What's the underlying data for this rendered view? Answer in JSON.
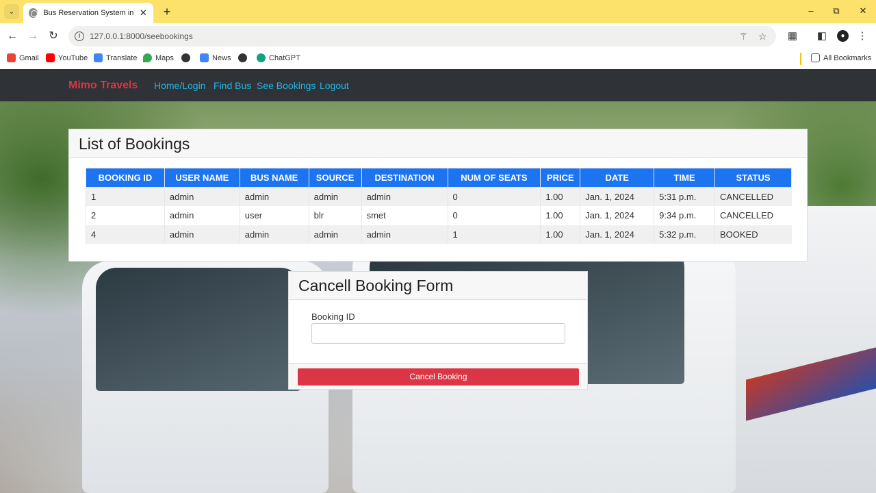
{
  "browser": {
    "tab_title": "Bus Reservation System in Djan",
    "url": "127.0.0.1:8000/seebookings",
    "bookmarks": [
      {
        "label": "Gmail",
        "icon": "gmail-icon",
        "color": "#ea4335"
      },
      {
        "label": "YouTube",
        "icon": "youtube-icon",
        "color": "#ff0000"
      },
      {
        "label": "Translate",
        "icon": "translate-icon",
        "color": "#4285f4"
      },
      {
        "label": "Maps",
        "icon": "maps-icon",
        "color": "#34a853"
      },
      {
        "label": "",
        "icon": "globe-icon",
        "color": "#333333"
      },
      {
        "label": "News",
        "icon": "news-icon",
        "color": "#4285f4"
      },
      {
        "label": "",
        "icon": "globe-icon",
        "color": "#333333"
      },
      {
        "label": "ChatGPT",
        "icon": "chatgpt-icon",
        "color": "#10a37f"
      }
    ],
    "all_bookmarks": "All Bookmarks"
  },
  "navbar": {
    "brand": "Mimo Travels",
    "links": [
      "Home/Login",
      "Find Bus",
      "See Bookings",
      "Logout"
    ]
  },
  "bookings": {
    "title": "List of Bookings",
    "columns": [
      "BOOKING ID",
      "USER NAME",
      "BUS NAME",
      "SOURCE",
      "DESTINATION",
      "NUM OF SEATS",
      "PRICE",
      "DATE",
      "TIME",
      "STATUS"
    ],
    "rows": [
      [
        "1",
        "admin",
        "admin",
        "admin",
        "admin",
        "0",
        "1.00",
        "Jan. 1, 2024",
        "5:31 p.m.",
        "CANCELLED"
      ],
      [
        "2",
        "admin",
        "user",
        "blr",
        "smet",
        "0",
        "1.00",
        "Jan. 1, 2024",
        "9:34 p.m.",
        "CANCELLED"
      ],
      [
        "4",
        "admin",
        "admin",
        "admin",
        "admin",
        "1",
        "1.00",
        "Jan. 1, 2024",
        "5:32 p.m.",
        "BOOKED"
      ]
    ]
  },
  "cancel_form": {
    "title": "Cancell Booking Form",
    "field_label": "Booking ID",
    "field_value": "",
    "submit_label": "Cancel Booking"
  },
  "colors": {
    "brand": "#dc3545",
    "nav_link": "#22b9e6",
    "table_header": "#1c74f0",
    "tab_strip": "#fce26b"
  }
}
